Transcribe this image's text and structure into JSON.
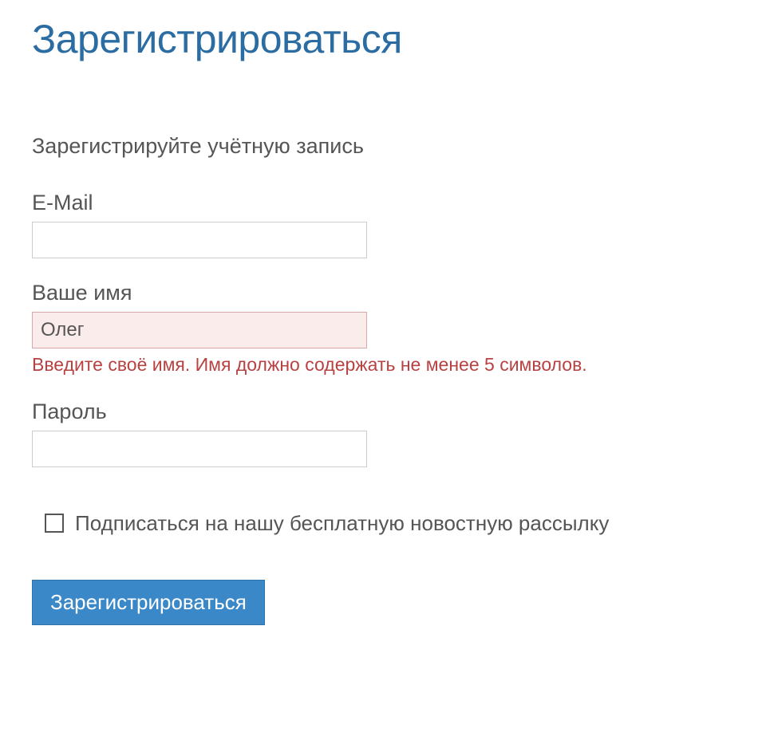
{
  "page": {
    "title": "Зарегистрироваться",
    "subtitle": "Зарегистрируйте учётную запись"
  },
  "form": {
    "email": {
      "label": "E-Mail",
      "value": ""
    },
    "name": {
      "label": "Ваше имя",
      "value": "Олег",
      "error": "Введите своё имя. Имя должно содержать не менее 5 символов."
    },
    "password": {
      "label": "Пароль",
      "value": ""
    },
    "newsletter": {
      "label": "Подписаться на нашу бесплатную новостную рассылку",
      "checked": false
    },
    "submit_label": "Зарегистрироваться"
  }
}
